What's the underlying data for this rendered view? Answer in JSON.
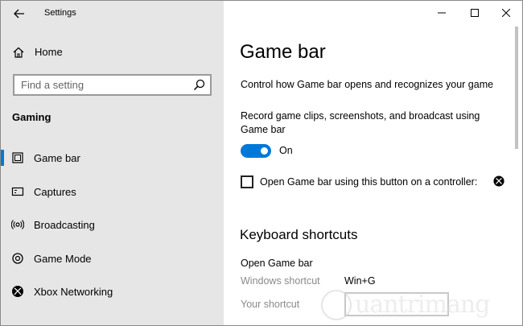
{
  "window": {
    "title": "Settings"
  },
  "sidebar": {
    "home_label": "Home",
    "search_placeholder": "Find a setting",
    "section_title": "Gaming",
    "items": [
      {
        "label": "Game bar",
        "icon": "game-bar-icon",
        "active": true
      },
      {
        "label": "Captures",
        "icon": "captures-icon",
        "active": false
      },
      {
        "label": "Broadcasting",
        "icon": "broadcasting-icon",
        "active": false
      },
      {
        "label": "Game Mode",
        "icon": "game-mode-icon",
        "active": false
      },
      {
        "label": "Xbox Networking",
        "icon": "xbox-icon",
        "active": false
      }
    ]
  },
  "main": {
    "title": "Game bar",
    "description": "Control how Game bar opens and recognizes your game",
    "record_label": "Record game clips, screenshots, and broadcast using Game bar",
    "toggle_state": "On",
    "toggle_on": true,
    "checkbox_label": "Open Game bar using this button on a controller:",
    "checkbox_checked": false,
    "keyboard_title": "Keyboard shortcuts",
    "shortcut_name": "Open Game bar",
    "windows_shortcut_label": "Windows shortcut",
    "windows_shortcut_value": "Win+G",
    "your_shortcut_label": "Your shortcut",
    "your_shortcut_value": ""
  },
  "watermark": {
    "text": "uantrimang"
  },
  "colors": {
    "accent": "#0078d7",
    "sidebar_bg": "#e6e6e6",
    "main_bg": "#ffffff"
  }
}
